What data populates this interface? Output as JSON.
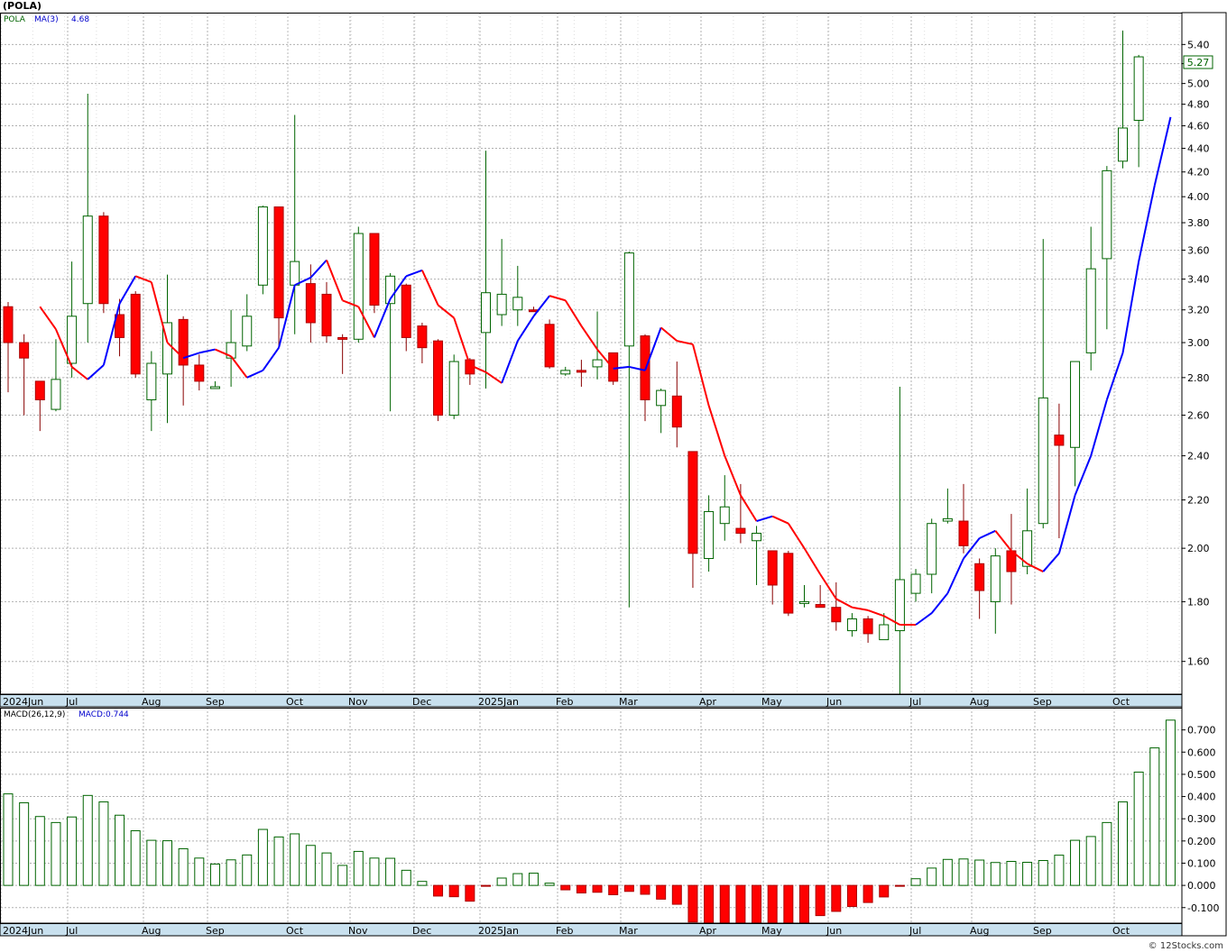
{
  "header": {
    "ticker": "(POLA)",
    "credit": "© 12Stocks.com"
  },
  "colors": {
    "up": "#006400",
    "down": "#ff0000",
    "ma_up": "#0000ff",
    "ma_down": "#ff0000",
    "grid": "#b0b0b0",
    "axis_band": "#c8e0ee"
  },
  "chart_data": [
    {
      "type": "candlestick",
      "legend": {
        "symbol": "POLA",
        "ma_label": "MA(3)",
        "ma_value": "4.68"
      },
      "x_labels": [
        "2024Jun",
        "Jul",
        "Aug",
        "Sep",
        "Oct",
        "Nov",
        "Dec",
        "2025Jan",
        "Feb",
        "Mar",
        "Apr",
        "May",
        "Jun",
        "Jul",
        "Aug",
        "Sep",
        "Oct"
      ],
      "y_ticks": [
        "1.60",
        "1.80",
        "2.00",
        "2.20",
        "2.40",
        "2.60",
        "2.80",
        "3.00",
        "3.20",
        "3.40",
        "3.60",
        "3.80",
        "4.00",
        "4.20",
        "4.40",
        "4.60",
        "4.80",
        "5.00",
        "5.20",
        "5.40"
      ],
      "y_scale": "log",
      "ylim": [
        1.5,
        5.75
      ],
      "last_price": "5.27",
      "candles": [
        {
          "o": 3.22,
          "h": 3.25,
          "l": 2.72,
          "c": 3.0
        },
        {
          "o": 3.0,
          "h": 3.05,
          "l": 2.6,
          "c": 2.91
        },
        {
          "o": 2.78,
          "h": 2.78,
          "l": 2.52,
          "c": 2.68
        },
        {
          "o": 2.63,
          "h": 3.02,
          "l": 2.62,
          "c": 2.79
        },
        {
          "o": 2.88,
          "h": 3.52,
          "l": 2.8,
          "c": 3.16
        },
        {
          "o": 3.24,
          "h": 4.9,
          "l": 3.0,
          "c": 3.85
        },
        {
          "o": 3.85,
          "h": 3.88,
          "l": 3.18,
          "c": 3.24
        },
        {
          "o": 3.17,
          "h": 3.27,
          "l": 2.92,
          "c": 3.03
        },
        {
          "o": 3.3,
          "h": 3.32,
          "l": 2.8,
          "c": 2.82
        },
        {
          "o": 2.68,
          "h": 2.95,
          "l": 2.52,
          "c": 2.88
        },
        {
          "o": 2.82,
          "h": 3.43,
          "l": 2.56,
          "c": 3.12
        },
        {
          "o": 3.14,
          "h": 3.16,
          "l": 2.65,
          "c": 2.87
        },
        {
          "o": 2.87,
          "h": 2.93,
          "l": 2.73,
          "c": 2.78
        },
        {
          "o": 2.75,
          "h": 2.78,
          "l": 2.74,
          "c": 2.75
        },
        {
          "o": 2.91,
          "h": 3.2,
          "l": 2.75,
          "c": 3.0
        },
        {
          "o": 2.98,
          "h": 3.3,
          "l": 2.95,
          "c": 3.16
        },
        {
          "o": 3.36,
          "h": 3.93,
          "l": 3.3,
          "c": 3.92
        },
        {
          "o": 3.92,
          "h": 3.92,
          "l": 2.97,
          "c": 3.15
        },
        {
          "o": 3.36,
          "h": 4.7,
          "l": 3.05,
          "c": 3.52
        },
        {
          "o": 3.37,
          "h": 3.5,
          "l": 3.0,
          "c": 3.12
        },
        {
          "o": 3.3,
          "h": 3.38,
          "l": 3.0,
          "c": 3.04
        },
        {
          "o": 3.03,
          "h": 3.05,
          "l": 2.82,
          "c": 3.02
        },
        {
          "o": 3.02,
          "h": 3.77,
          "l": 3.0,
          "c": 3.72
        },
        {
          "o": 3.72,
          "h": 3.72,
          "l": 3.18,
          "c": 3.23
        },
        {
          "o": 3.24,
          "h": 3.44,
          "l": 2.62,
          "c": 3.42
        },
        {
          "o": 3.36,
          "h": 3.37,
          "l": 2.95,
          "c": 3.03
        },
        {
          "o": 3.1,
          "h": 3.12,
          "l": 2.88,
          "c": 2.97
        },
        {
          "o": 3.01,
          "h": 3.02,
          "l": 2.57,
          "c": 2.6
        },
        {
          "o": 2.6,
          "h": 2.93,
          "l": 2.58,
          "c": 2.89
        },
        {
          "o": 2.9,
          "h": 2.91,
          "l": 2.76,
          "c": 2.82
        },
        {
          "o": 3.06,
          "h": 4.38,
          "l": 2.74,
          "c": 3.31
        },
        {
          "o": 3.17,
          "h": 3.68,
          "l": 3.1,
          "c": 3.3
        },
        {
          "o": 3.2,
          "h": 3.49,
          "l": 3.1,
          "c": 3.28
        },
        {
          "o": 3.2,
          "h": 3.22,
          "l": 3.19,
          "c": 3.19
        },
        {
          "o": 3.11,
          "h": 3.14,
          "l": 2.85,
          "c": 2.86
        },
        {
          "o": 2.82,
          "h": 2.86,
          "l": 2.81,
          "c": 2.84
        },
        {
          "o": 2.84,
          "h": 2.9,
          "l": 2.75,
          "c": 2.83
        },
        {
          "o": 2.86,
          "h": 3.19,
          "l": 2.79,
          "c": 2.9
        },
        {
          "o": 2.94,
          "h": 2.94,
          "l": 2.76,
          "c": 2.78
        },
        {
          "o": 2.98,
          "h": 3.59,
          "l": 1.78,
          "c": 3.58
        },
        {
          "o": 3.04,
          "h": 3.05,
          "l": 2.57,
          "c": 2.68
        },
        {
          "o": 2.65,
          "h": 2.74,
          "l": 2.51,
          "c": 2.73
        },
        {
          "o": 2.7,
          "h": 2.89,
          "l": 2.44,
          "c": 2.54
        },
        {
          "o": 2.42,
          "h": 2.42,
          "l": 1.85,
          "c": 1.98
        },
        {
          "o": 1.96,
          "h": 2.22,
          "l": 1.91,
          "c": 2.15
        },
        {
          "o": 2.1,
          "h": 2.31,
          "l": 2.03,
          "c": 2.17
        },
        {
          "o": 2.08,
          "h": 2.27,
          "l": 2.02,
          "c": 2.06
        },
        {
          "o": 2.03,
          "h": 2.09,
          "l": 1.86,
          "c": 2.06
        },
        {
          "o": 1.99,
          "h": 1.99,
          "l": 1.79,
          "c": 1.86
        },
        {
          "o": 1.98,
          "h": 1.99,
          "l": 1.75,
          "c": 1.76
        },
        {
          "o": 1.8,
          "h": 1.86,
          "l": 1.78,
          "c": 1.8
        },
        {
          "o": 1.79,
          "h": 1.86,
          "l": 1.78,
          "c": 1.78
        },
        {
          "o": 1.78,
          "h": 1.87,
          "l": 1.7,
          "c": 1.73
        },
        {
          "o": 1.7,
          "h": 1.76,
          "l": 1.68,
          "c": 1.74
        },
        {
          "o": 1.74,
          "h": 1.75,
          "l": 1.66,
          "c": 1.69
        },
        {
          "o": 1.67,
          "h": 1.76,
          "l": 1.67,
          "c": 1.72
        },
        {
          "o": 1.7,
          "h": 2.75,
          "l": 1.5,
          "c": 1.88
        },
        {
          "o": 1.83,
          "h": 1.92,
          "l": 1.8,
          "c": 1.9
        },
        {
          "o": 1.9,
          "h": 2.12,
          "l": 1.83,
          "c": 2.1
        },
        {
          "o": 2.11,
          "h": 2.25,
          "l": 2.1,
          "c": 2.12
        },
        {
          "o": 2.11,
          "h": 2.27,
          "l": 1.98,
          "c": 2.01
        },
        {
          "o": 1.94,
          "h": 1.96,
          "l": 1.74,
          "c": 1.84
        },
        {
          "o": 1.8,
          "h": 2.0,
          "l": 1.69,
          "c": 1.97
        },
        {
          "o": 1.99,
          "h": 2.14,
          "l": 1.79,
          "c": 1.91
        },
        {
          "o": 1.93,
          "h": 2.25,
          "l": 1.9,
          "c": 2.07
        },
        {
          "o": 2.1,
          "h": 3.68,
          "l": 2.08,
          "c": 2.69
        },
        {
          "o": 2.5,
          "h": 2.66,
          "l": 2.04,
          "c": 2.45
        },
        {
          "o": 2.44,
          "h": 2.89,
          "l": 2.26,
          "c": 2.89
        },
        {
          "o": 2.94,
          "h": 3.77,
          "l": 2.84,
          "c": 3.47
        },
        {
          "o": 3.54,
          "h": 4.25,
          "l": 3.08,
          "c": 4.21
        },
        {
          "o": 4.29,
          "h": 5.55,
          "l": 4.23,
          "c": 4.58
        },
        {
          "o": 4.65,
          "h": 5.29,
          "l": 4.24,
          "c": 5.27
        }
      ],
      "ma3": [
        3.22,
        3.08,
        2.86,
        2.79,
        2.87,
        3.24,
        3.42,
        3.38,
        3.0,
        2.91,
        2.94,
        2.96,
        2.92,
        2.8,
        2.84,
        2.97,
        3.36,
        3.41,
        3.53,
        3.26,
        3.22,
        3.03,
        3.27,
        3.42,
        3.46,
        3.23,
        3.15,
        2.87,
        2.83,
        2.77,
        3.01,
        3.16,
        3.29,
        3.26,
        3.1,
        2.96,
        2.85,
        2.86,
        2.84,
        3.09,
        3.01,
        2.99,
        2.65,
        2.4,
        2.22,
        2.11,
        2.13,
        2.1,
        2.0,
        1.9,
        1.81,
        1.78,
        1.77,
        1.75,
        1.72,
        1.72,
        1.76,
        1.83,
        1.96,
        2.04,
        2.07,
        1.99,
        1.94,
        1.91,
        1.98,
        2.22,
        2.4,
        2.68,
        2.94,
        3.52,
        4.09,
        4.68
      ],
      "ma3_colors": [
        "d",
        "d",
        "d",
        "d",
        "u",
        "u",
        "u",
        "d",
        "d",
        "d",
        "u",
        "u",
        "d",
        "d",
        "u",
        "u",
        "u",
        "u",
        "u",
        "d",
        "d",
        "d",
        "u",
        "u",
        "u",
        "d",
        "d",
        "d",
        "d",
        "d",
        "u",
        "u",
        "u",
        "d",
        "d",
        "d",
        "d",
        "u",
        "u",
        "u",
        "d",
        "d",
        "d",
        "d",
        "d",
        "d",
        "u",
        "d",
        "d",
        "d",
        "d",
        "d",
        "d",
        "d",
        "d",
        "d",
        "u",
        "u",
        "u",
        "u",
        "u",
        "d",
        "d",
        "d",
        "u",
        "u",
        "u",
        "u",
        "u",
        "u",
        "u",
        "u"
      ]
    },
    {
      "type": "bar",
      "legend": {
        "label": "MACD(26,12,9)",
        "value_label": "MACD:0.744"
      },
      "x_labels": [
        "2024Jun",
        "Jul",
        "Aug",
        "Sep",
        "Oct",
        "Nov",
        "Dec",
        "2025Jan",
        "Feb",
        "Mar",
        "Apr",
        "May",
        "Jun",
        "Jul",
        "Aug",
        "Sep",
        "Oct"
      ],
      "y_ticks": [
        "-0.100",
        "0.000",
        "0.100",
        "0.200",
        "0.300",
        "0.400",
        "0.500",
        "0.600",
        "0.700"
      ],
      "ylim": [
        -0.17,
        0.8
      ],
      "values": [
        0.412,
        0.372,
        0.31,
        0.283,
        0.308,
        0.405,
        0.376,
        0.316,
        0.246,
        0.203,
        0.201,
        0.165,
        0.123,
        0.096,
        0.115,
        0.137,
        0.252,
        0.218,
        0.232,
        0.18,
        0.146,
        0.09,
        0.153,
        0.123,
        0.122,
        0.068,
        0.018,
        -0.048,
        -0.051,
        -0.071,
        -0.003,
        0.033,
        0.053,
        0.055,
        0.01,
        -0.02,
        -0.034,
        -0.031,
        -0.042,
        -0.027,
        -0.04,
        -0.062,
        -0.085,
        -0.165,
        -0.196,
        -0.208,
        -0.205,
        -0.195,
        -0.178,
        -0.188,
        -0.175,
        -0.136,
        -0.117,
        -0.095,
        -0.077,
        -0.052,
        -0.002,
        0.03,
        0.078,
        0.117,
        0.119,
        0.114,
        0.103,
        0.108,
        0.104,
        0.112,
        0.136,
        0.203,
        0.22,
        0.283,
        0.376,
        0.51,
        0.619,
        0.744
      ]
    }
  ]
}
